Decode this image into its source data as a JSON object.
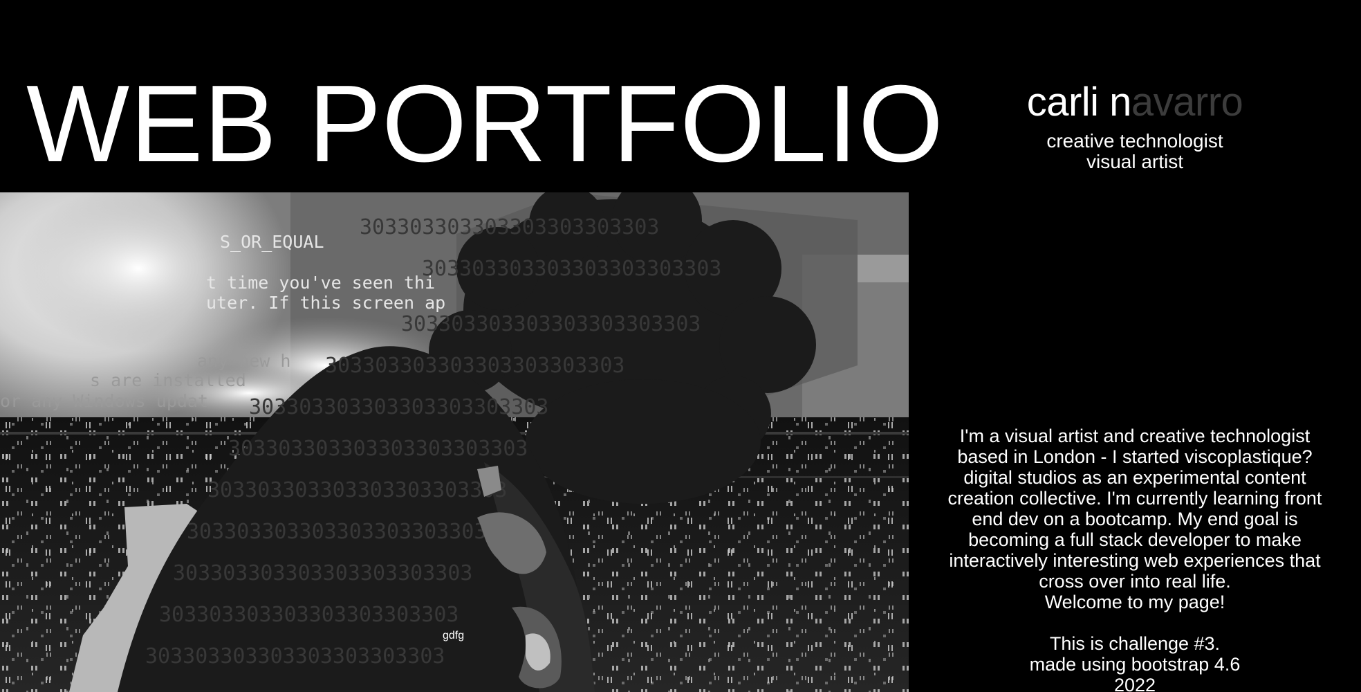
{
  "hero": {
    "title": "WEB PORTFOLIO",
    "photo_caption": "gdfg",
    "background_text": {
      "line1": "S_OR_EQUAL",
      "line2": "t time you've seen thi",
      "line3": "uter. If this screen ap",
      "line4": "any new h",
      "line5": "s are installed",
      "line6": "or any Windows updat",
      "repeat_number": "303303303303303303303303"
    }
  },
  "profile": {
    "name_lit": "carli n",
    "name_dim": "avarro",
    "role_line1": "creative technologist",
    "role_line2": "visual artist"
  },
  "bio": {
    "line1": "I'm a visual artist and creative technologist",
    "line2": "based in London - I started viscoplastique?",
    "line3": "digital studios as an experimental content",
    "line4": "creation collective. I'm currently learning front",
    "line5": "end dev on a bootcamp. My end goal is",
    "line6": "becoming a full stack developer to make",
    "line7": "interactively interesting web experiences that",
    "line8": "cross over into real life.",
    "welcome": "Welcome to my page!",
    "challenge": "This is challenge #3.",
    "made_with": "made using bootstrap 4.6",
    "year": "2022"
  }
}
